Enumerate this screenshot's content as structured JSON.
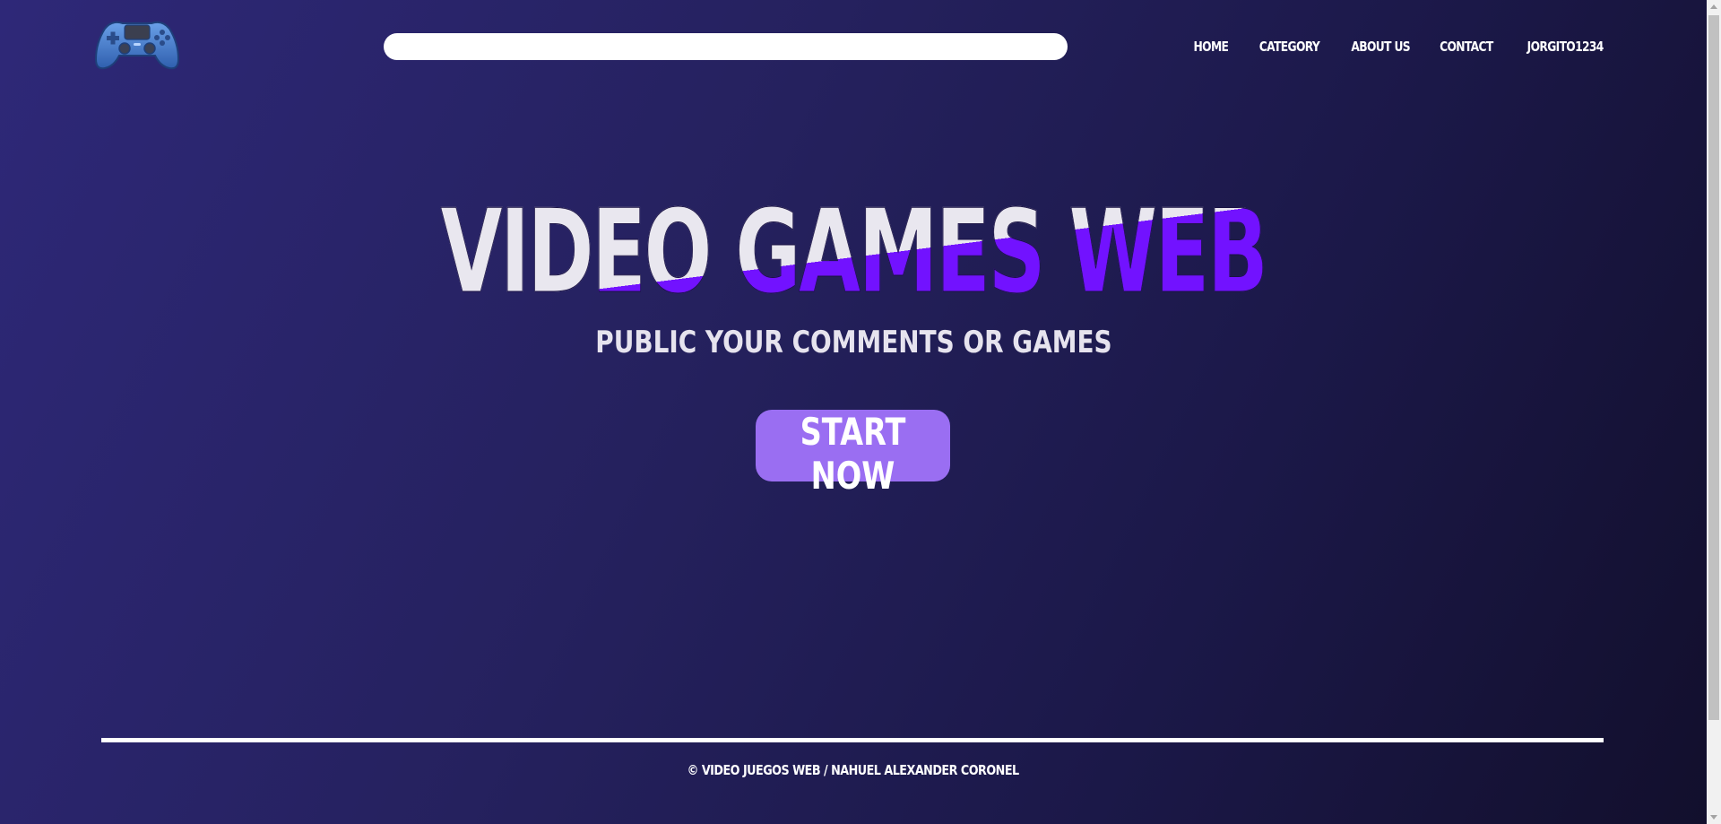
{
  "header": {
    "logo_icon": "gamepad-controller-icon",
    "search": {
      "value": "",
      "placeholder": ""
    },
    "nav": [
      {
        "label": "HOME"
      },
      {
        "label": "CATEGORY"
      },
      {
        "label": "ABOUT US"
      },
      {
        "label": "CONTACT"
      },
      {
        "label": "JORGITO1234"
      }
    ]
  },
  "hero": {
    "title": "VIDEO GAMES WEB",
    "subtitle": "PUBLIC YOUR COMMENTS OR GAMES",
    "cta_label": "START NOW"
  },
  "footer": {
    "copyright": "© VIDEO JUEGOS WEB / NAHUEL ALEXANDER CORONEL"
  },
  "colors": {
    "background_start": "#2e2878",
    "background_end": "#120f2c",
    "title_top": "#e9e7ef",
    "title_bottom": "#7212ff",
    "button": "#9a6ef2"
  }
}
